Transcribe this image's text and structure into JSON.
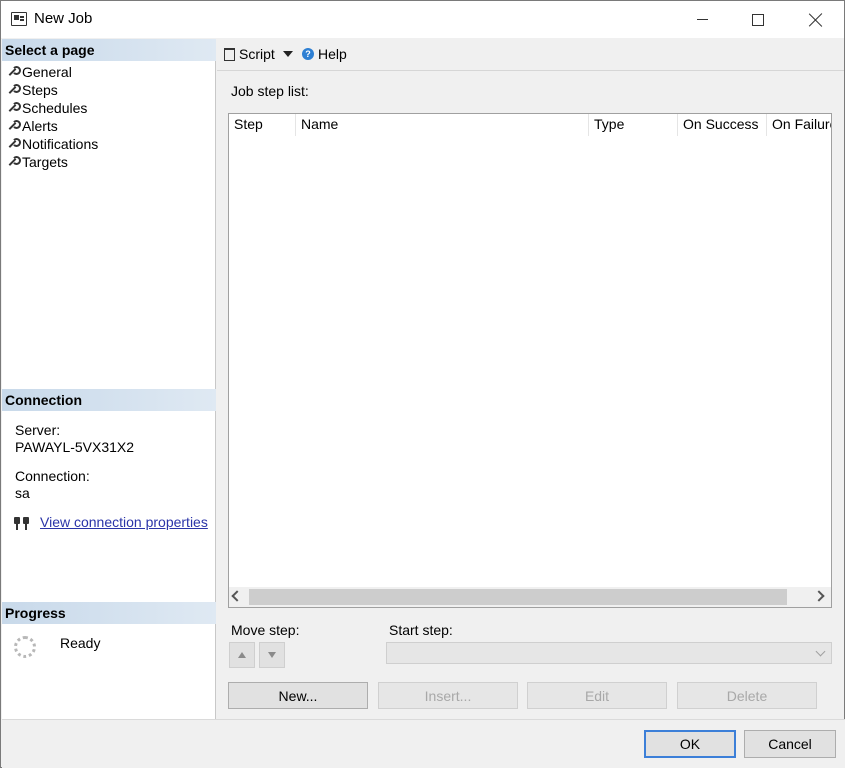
{
  "window": {
    "title": "New Job"
  },
  "left_pane": {
    "select_page_header": "Select a page",
    "pages": [
      {
        "label": "General"
      },
      {
        "label": "Steps"
      },
      {
        "label": "Schedules"
      },
      {
        "label": "Alerts"
      },
      {
        "label": "Notifications"
      },
      {
        "label": "Targets"
      }
    ],
    "connection": {
      "header": "Connection",
      "server_label": "Server:",
      "server_value": "PAWAYL-5VX31X2",
      "connection_label": "Connection:",
      "connection_value": "sa",
      "view_link": "View connection properties"
    },
    "progress": {
      "header": "Progress",
      "status": "Ready"
    }
  },
  "toolbar": {
    "script_label": "Script",
    "help_label": "Help"
  },
  "main": {
    "job_step_list_label": "Job step list:",
    "columns": [
      "Step",
      "Name",
      "Type",
      "On Success",
      "On Failure"
    ],
    "rows": [],
    "move_step_label": "Move step:",
    "start_step_label": "Start step:",
    "start_step_value": "",
    "buttons": {
      "new": "New...",
      "insert": "Insert...",
      "edit": "Edit",
      "delete": "Delete"
    }
  },
  "dialog_buttons": {
    "ok": "OK",
    "cancel": "Cancel"
  },
  "colors": {
    "section_header": "#c8d9ea",
    "link": "#2a34a8",
    "ok_focus_border": "#3c7fd8"
  }
}
